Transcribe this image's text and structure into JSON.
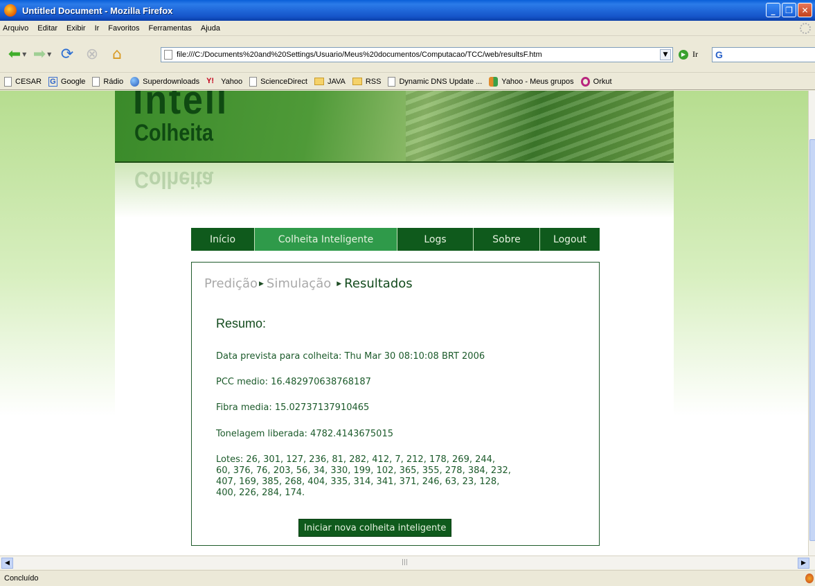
{
  "window": {
    "title": "Untitled Document - Mozilla Firefox"
  },
  "menubar": {
    "items": [
      "Arquivo",
      "Editar",
      "Exibir",
      "Ir",
      "Favoritos",
      "Ferramentas",
      "Ajuda"
    ]
  },
  "toolbar": {
    "url": "file:///C:/Documents%20and%20Settings/Usuario/Meus%20documentos/Computacao/TCC/web/resultsF.htm",
    "go_label": "Ir"
  },
  "bookmarks": [
    {
      "label": "CESAR",
      "icon": "page-icon"
    },
    {
      "label": "Google",
      "icon": "google-icon"
    },
    {
      "label": "Rádio",
      "icon": "page-icon"
    },
    {
      "label": "Superdownloads",
      "icon": "globe-icon"
    },
    {
      "label": "Yahoo",
      "icon": "yahoo-icon"
    },
    {
      "label": "ScienceDirect",
      "icon": "page-icon"
    },
    {
      "label": "JAVA",
      "icon": "folder-icon"
    },
    {
      "label": "RSS",
      "icon": "folder-icon"
    },
    {
      "label": "Dynamic DNS Update ...",
      "icon": "page-icon"
    },
    {
      "label": "Yahoo - Meus grupos",
      "icon": "groups-icon"
    },
    {
      "label": "Orkut",
      "icon": "orkut-icon"
    }
  ],
  "site": {
    "logo_top": "Intell",
    "logo_bottom": "Colheita",
    "logo_reflection": "Colheita",
    "nav": [
      {
        "label": "Início",
        "active": false
      },
      {
        "label": "Colheita Inteligente",
        "active": true
      },
      {
        "label": "Logs",
        "active": false
      },
      {
        "label": "Sobre",
        "active": false
      },
      {
        "label": "Logout",
        "active": false
      }
    ],
    "breadcrumb": {
      "step1": "Predição",
      "step2": "Simulação",
      "step3": "Resultados"
    },
    "resumo_title": "Resumo:",
    "data_prevista": "Data prevista para colheita: Thu Mar 30 08:10:08 BRT 2006",
    "pcc_medio": "PCC medio: 16.482970638768187",
    "fibra_media": "Fibra media: 15.02737137910465",
    "tonelagem": "Tonelagem liberada: 4782.4143675015",
    "lotes_line1": "Lotes: 26, 301, 127, 236, 81, 282, 412, 7, 212, 178, 269, 244,",
    "lotes_line2": "60, 376, 76, 203, 56, 34, 330, 199, 102, 365, 355, 278, 384, 232,",
    "lotes_line3": "407, 169, 385, 268, 404, 335, 314, 341, 371, 246, 63, 23, 128,",
    "lotes_line4": "400, 226, 284, 174.",
    "new_button": "Iniciar nova colheita inteligente"
  },
  "status": {
    "text": "Concluído"
  }
}
